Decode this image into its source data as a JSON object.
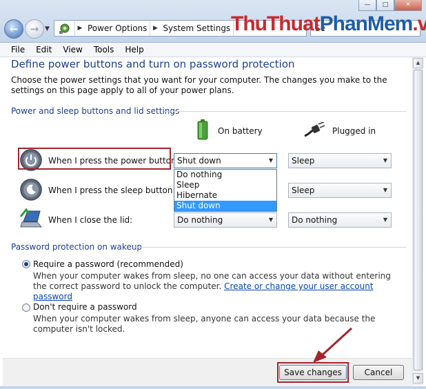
{
  "window": {
    "min_glyph": "—",
    "max_glyph": "□",
    "close_glyph": "✕"
  },
  "address": {
    "crumbs": [
      "Power Options",
      "System Settings"
    ],
    "search_placeholder": "Se"
  },
  "watermark": {
    "part1": "ThuThuat",
    "part2": "PhanMem",
    "part3": ".vn"
  },
  "menu": [
    "File",
    "Edit",
    "View",
    "Tools",
    "Help"
  ],
  "page": {
    "title": "Define power buttons and turn on password protection",
    "intro": "Choose the power settings that you want for your computer. The changes you make to the settings on this page apply to all of your power plans."
  },
  "buttons_section": {
    "title": "Power and sleep buttons and lid settings",
    "col_battery": "On battery",
    "col_plugged": "Plugged in",
    "rows": [
      {
        "label": "When I press the power button:",
        "battery": "Shut down",
        "plugged": "Sleep"
      },
      {
        "label": "When I press the sleep button:",
        "battery": "",
        "plugged": "Sleep"
      },
      {
        "label": "When I close the lid:",
        "battery": "Do nothing",
        "plugged": "Do nothing"
      }
    ],
    "dropdown_options": [
      "Do nothing",
      "Sleep",
      "Hibernate",
      "Shut down"
    ],
    "dropdown_selected": "Shut down"
  },
  "password_section": {
    "title": "Password protection on wakeup",
    "require_label": "Require a password (recommended)",
    "require_desc_1": "When your computer wakes from sleep, no one can access your data without entering the correct password to unlock the computer.",
    "require_link": "Create or change your user account password",
    "norequire_label": "Don't require a password",
    "norequire_desc": "When your computer wakes from sleep, anyone can access your data because the computer isn't locked.",
    "selected": "require"
  },
  "footer": {
    "save_label": "Save changes",
    "cancel_label": "Cancel"
  },
  "colors": {
    "heading": "#1e3f8f",
    "highlight": "#a5232b",
    "selection": "#3399ff",
    "watermark_red": "#c62a2f",
    "watermark_blue": "#1e5da8"
  },
  "icons": [
    "back-arrow-icon",
    "forward-arrow-icon",
    "control-panel-icon",
    "battery-icon",
    "power-plug-icon",
    "power-button-icon",
    "sleep-button-icon",
    "laptop-lid-icon"
  ]
}
